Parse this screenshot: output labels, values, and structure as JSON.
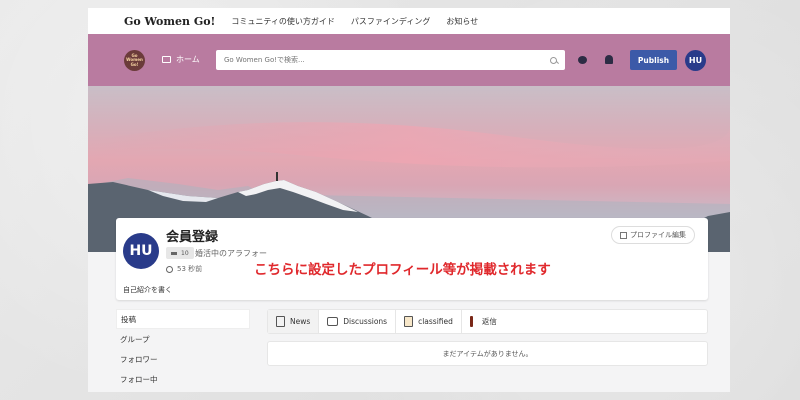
{
  "topnav": {
    "brand": "Go Women Go!",
    "links": [
      "コミュニティの使い方ガイド",
      "パスファインディング",
      "お知らせ"
    ]
  },
  "header": {
    "logo_text": "Go Women Go!",
    "home_label": "ホーム",
    "search_placeholder": "Go Women Go!で検索...",
    "publish_label": "Publish",
    "avatar_initials": "HU"
  },
  "profile": {
    "avatar_initials": "HU",
    "name": "会員登録",
    "badge_count": "10",
    "tagline": "婚活中のアラフォー",
    "time": "53 秒前",
    "bio_prompt": "自己紹介を書く",
    "edit_label": "プロファイル編集"
  },
  "annotation": "こちらに設定したプロフィール等が掲載されます",
  "sidebar": {
    "items": [
      "投稿",
      "グループ",
      "フォロワー",
      "フォロー中"
    ]
  },
  "tabs": [
    "News",
    "Discussions",
    "classified",
    "返信"
  ],
  "empty_message": "まだアイテムがありません。",
  "colors": {
    "header_pink": "#b97ba0",
    "publish_blue": "#3c5aa8",
    "avatar_navy": "#293b8a",
    "annotation_red": "#e0282c"
  }
}
